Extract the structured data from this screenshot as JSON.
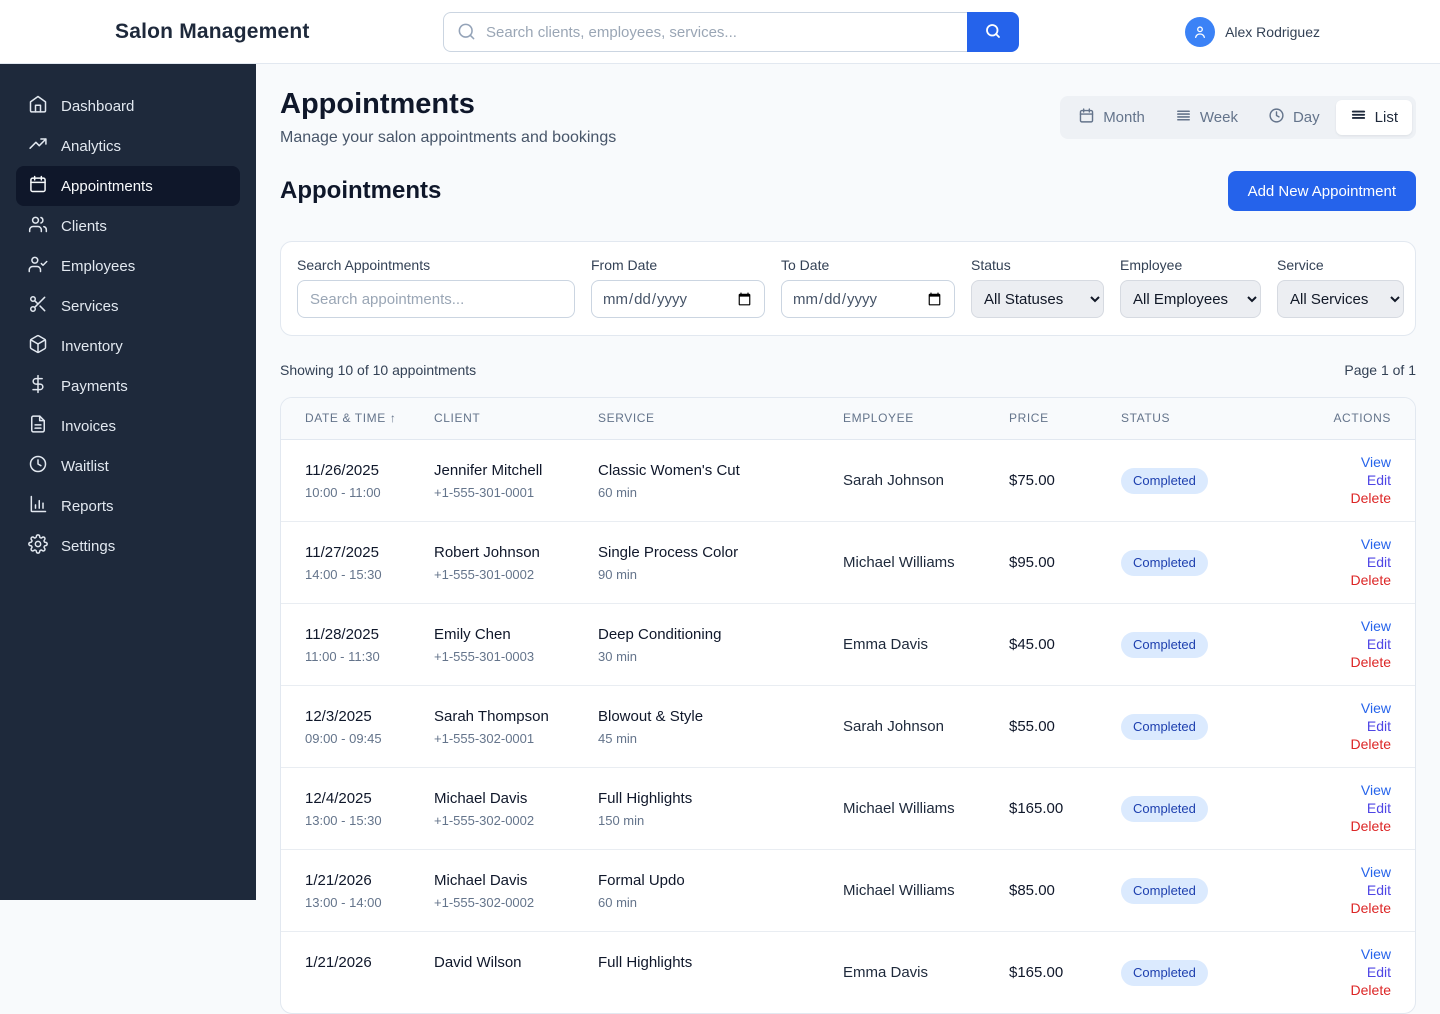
{
  "header": {
    "brand": "Salon Management",
    "search_placeholder": "Search clients, employees, services...",
    "user_name": "Alex Rodriguez"
  },
  "sidebar": {
    "items": [
      {
        "label": "Dashboard",
        "icon": "home-icon",
        "active": false
      },
      {
        "label": "Analytics",
        "icon": "trending-up-icon",
        "active": false
      },
      {
        "label": "Appointments",
        "icon": "calendar-icon",
        "active": true
      },
      {
        "label": "Clients",
        "icon": "users-icon",
        "active": false
      },
      {
        "label": "Employees",
        "icon": "user-check-icon",
        "active": false
      },
      {
        "label": "Services",
        "icon": "scissors-icon",
        "active": false
      },
      {
        "label": "Inventory",
        "icon": "package-icon",
        "active": false
      },
      {
        "label": "Payments",
        "icon": "dollar-icon",
        "active": false
      },
      {
        "label": "Invoices",
        "icon": "file-text-icon",
        "active": false
      },
      {
        "label": "Waitlist",
        "icon": "clock-icon",
        "active": false
      },
      {
        "label": "Reports",
        "icon": "bar-chart-icon",
        "active": false
      },
      {
        "label": "Settings",
        "icon": "gear-icon",
        "active": false
      }
    ]
  },
  "page": {
    "title": "Appointments",
    "subtitle": "Manage your salon appointments and bookings",
    "view_toggle": {
      "month": "Month",
      "week": "Week",
      "day": "Day",
      "list": "List",
      "active": "List"
    },
    "section_title": "Appointments",
    "add_button_label": "Add New Appointment"
  },
  "filters": {
    "search_label": "Search Appointments",
    "search_placeholder": "Search appointments...",
    "from_date_label": "From Date",
    "to_date_label": "To Date",
    "date_placeholder": "mm/dd/yyyy",
    "status_label": "Status",
    "status_value": "All Statuses",
    "employee_label": "Employee",
    "employee_value": "All Employees",
    "service_label": "Service",
    "service_value": "All Services"
  },
  "summary": {
    "showing": "Showing 10 of 10 appointments",
    "page": "Page 1 of 1"
  },
  "table": {
    "columns": {
      "date": "DATE & TIME",
      "client": "CLIENT",
      "service": "SERVICE",
      "employee": "EMPLOYEE",
      "price": "PRICE",
      "status": "STATUS",
      "actions": "ACTIONS"
    },
    "sort_indicator": "↑",
    "actions": {
      "view": "View",
      "edit": "Edit",
      "delete": "Delete"
    },
    "rows": [
      {
        "date": "11/26/2025",
        "time": "10:00 - 11:00",
        "client": "Jennifer Mitchell",
        "phone": "+1-555-301-0001",
        "service": "Classic Women's Cut",
        "duration": "60 min",
        "employee": "Sarah Johnson",
        "price": "$75.00",
        "status": "Completed"
      },
      {
        "date": "11/27/2025",
        "time": "14:00 - 15:30",
        "client": "Robert Johnson",
        "phone": "+1-555-301-0002",
        "service": "Single Process Color",
        "duration": "90 min",
        "employee": "Michael Williams",
        "price": "$95.00",
        "status": "Completed"
      },
      {
        "date": "11/28/2025",
        "time": "11:00 - 11:30",
        "client": "Emily Chen",
        "phone": "+1-555-301-0003",
        "service": "Deep Conditioning",
        "duration": "30 min",
        "employee": "Emma Davis",
        "price": "$45.00",
        "status": "Completed"
      },
      {
        "date": "12/3/2025",
        "time": "09:00 - 09:45",
        "client": "Sarah Thompson",
        "phone": "+1-555-302-0001",
        "service": "Blowout & Style",
        "duration": "45 min",
        "employee": "Sarah Johnson",
        "price": "$55.00",
        "status": "Completed"
      },
      {
        "date": "12/4/2025",
        "time": "13:00 - 15:30",
        "client": "Michael Davis",
        "phone": "+1-555-302-0002",
        "service": "Full Highlights",
        "duration": "150 min",
        "employee": "Michael Williams",
        "price": "$165.00",
        "status": "Completed"
      },
      {
        "date": "1/21/2026",
        "time": "13:00 - 14:00",
        "client": "Michael Davis",
        "phone": "+1-555-302-0002",
        "service": "Formal Updo",
        "duration": "60 min",
        "employee": "Michael Williams",
        "price": "$85.00",
        "status": "Completed"
      },
      {
        "date": "1/21/2026",
        "time": "",
        "client": "David Wilson",
        "phone": "",
        "service": "Full Highlights",
        "duration": "",
        "employee": "Emma Davis",
        "price": "$165.00",
        "status": "Completed"
      }
    ]
  },
  "colors": {
    "accent": "#2563eb",
    "sidebar_bg": "#1e293b",
    "sidebar_active_bg": "#0f172a",
    "avatar_bg": "#3b82f6",
    "badge_bg": "#dbeafe",
    "badge_text": "#1e40af",
    "edit_link": "#4f46e5",
    "delete_link": "#dc2626",
    "page_bg": "#f8fafc"
  }
}
